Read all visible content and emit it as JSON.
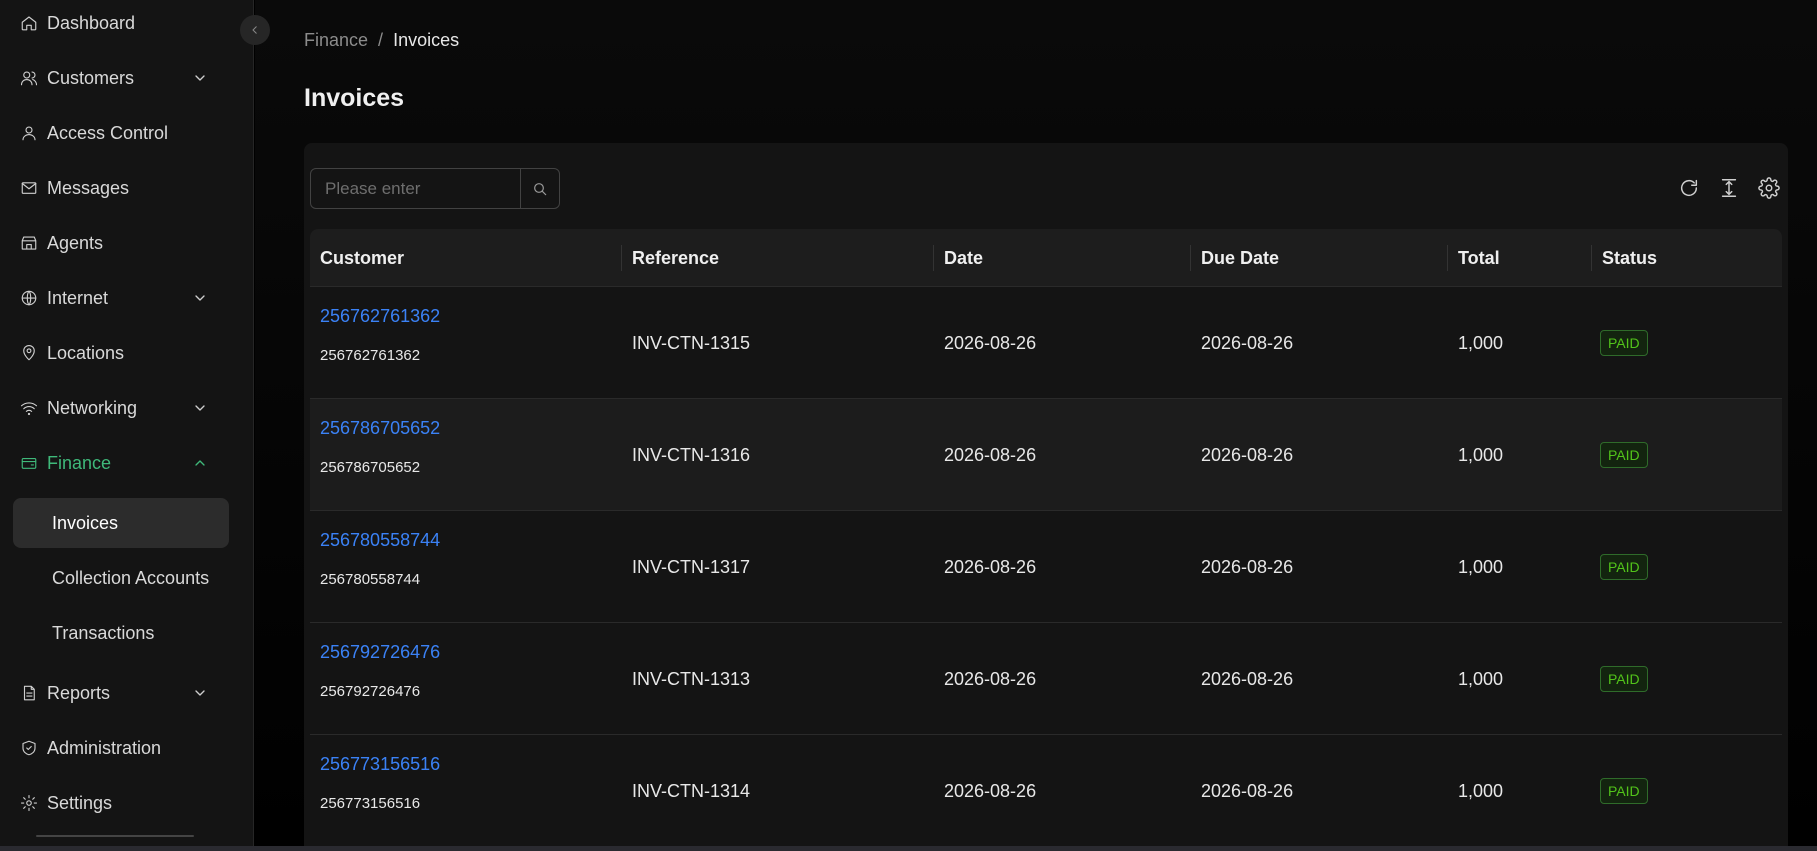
{
  "sidebar": {
    "items": [
      {
        "label": "Dashboard",
        "icon": "home-icon"
      },
      {
        "label": "Customers",
        "icon": "users-icon"
      },
      {
        "label": "Access Control",
        "icon": "user-icon"
      },
      {
        "label": "Messages",
        "icon": "mail-icon"
      },
      {
        "label": "Agents",
        "icon": "store-icon"
      },
      {
        "label": "Internet",
        "icon": "globe-icon"
      },
      {
        "label": "Locations",
        "icon": "map-pin-icon"
      },
      {
        "label": "Networking",
        "icon": "wifi-icon"
      },
      {
        "label": "Finance",
        "icon": "wallet-icon"
      },
      {
        "label": "Reports",
        "icon": "file-icon"
      },
      {
        "label": "Administration",
        "icon": "shield-icon"
      },
      {
        "label": "Settings",
        "icon": "gear-icon"
      }
    ],
    "finance_sub": [
      "Invoices",
      "Collection Accounts",
      "Transactions"
    ]
  },
  "breadcrumb": {
    "parent": "Finance",
    "separator": "/",
    "current": "Invoices"
  },
  "page_title": "Invoices",
  "search": {
    "placeholder": "Please enter",
    "value": ""
  },
  "table": {
    "headers": [
      "Customer",
      "Reference",
      "Date",
      "Due Date",
      "Total",
      "Status"
    ],
    "rows": [
      {
        "customer_link": "256762761362",
        "customer_sub": "256762761362",
        "reference": "INV-CTN-1315",
        "date": "2026-08-26",
        "due_date": "2026-08-26",
        "total": "1,000",
        "status": "PAID"
      },
      {
        "customer_link": "256786705652",
        "customer_sub": "256786705652",
        "reference": "INV-CTN-1316",
        "date": "2026-08-26",
        "due_date": "2026-08-26",
        "total": "1,000",
        "status": "PAID"
      },
      {
        "customer_link": "256780558744",
        "customer_sub": "256780558744",
        "reference": "INV-CTN-1317",
        "date": "2026-08-26",
        "due_date": "2026-08-26",
        "total": "1,000",
        "status": "PAID"
      },
      {
        "customer_link": "256792726476",
        "customer_sub": "256792726476",
        "reference": "INV-CTN-1313",
        "date": "2026-08-26",
        "due_date": "2026-08-26",
        "total": "1,000",
        "status": "PAID"
      },
      {
        "customer_link": "256773156516",
        "customer_sub": "256773156516",
        "reference": "INV-CTN-1314",
        "date": "2026-08-26",
        "due_date": "2026-08-26",
        "total": "1,000",
        "status": "PAID"
      }
    ]
  },
  "colors": {
    "accent": "#3fb97a",
    "link": "#3b82f6",
    "paid": "#52c41a"
  }
}
